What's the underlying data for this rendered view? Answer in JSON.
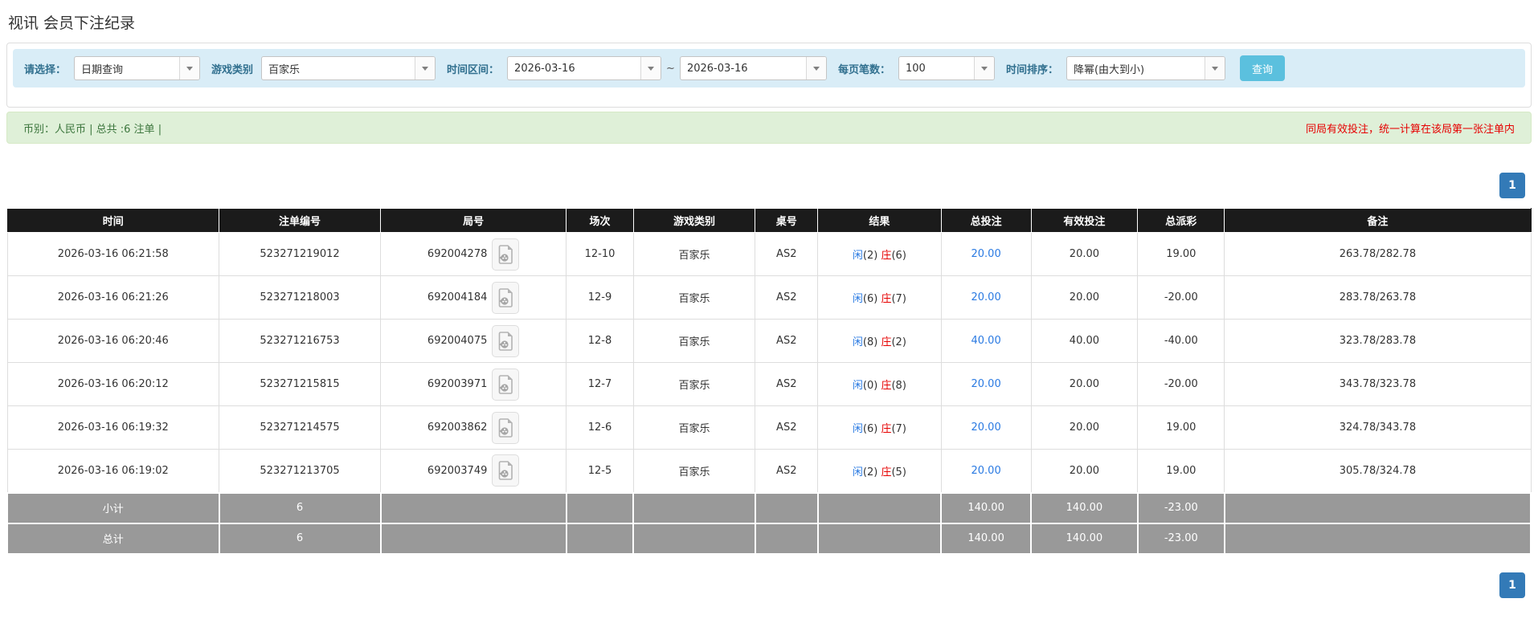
{
  "page": {
    "title": "视讯 会员下注纪录"
  },
  "filters": {
    "select_label": "请选择：",
    "select_value": "日期查询",
    "game_type_label": "游戏类别",
    "game_type_value": "百家乐",
    "date_range_label": "时间区间：",
    "date_from": "2026-03-16",
    "tilde": "~",
    "date_to": "2026-03-16",
    "page_size_label": "每页笔数：",
    "page_size_value": "100",
    "sort_label": "时间排序：",
    "sort_value": "降幂(由大到小)",
    "search_button": "查询"
  },
  "summary": {
    "left_text": "币别：人民币 | 总共 :6 注单 |",
    "right_note": "同局有效投注，统一计算在该局第一张注单内"
  },
  "pagination": {
    "page": "1"
  },
  "table": {
    "headers": [
      "时间",
      "注单编号",
      "局号",
      "场次",
      "游戏类别",
      "桌号",
      "结果",
      "总投注",
      "有效投注",
      "总派彩",
      "备注"
    ],
    "rows": [
      {
        "time": "2026-03-16 06:21:58",
        "bet_id": "523271219012",
        "round_id": "692004278",
        "session": "12-10",
        "game": "百家乐",
        "table_no": "AS2",
        "player_label": "闲",
        "player_num": "(2)",
        "banker_label": "庄",
        "banker_num": "(6)",
        "total_bet": "20.00",
        "valid_bet": "20.00",
        "payout": "19.00",
        "remark": "263.78/282.78"
      },
      {
        "time": "2026-03-16 06:21:26",
        "bet_id": "523271218003",
        "round_id": "692004184",
        "session": "12-9",
        "game": "百家乐",
        "table_no": "AS2",
        "player_label": "闲",
        "player_num": "(6)",
        "banker_label": "庄",
        "banker_num": "(7)",
        "total_bet": "20.00",
        "valid_bet": "20.00",
        "payout": "-20.00",
        "remark": "283.78/263.78"
      },
      {
        "time": "2026-03-16 06:20:46",
        "bet_id": "523271216753",
        "round_id": "692004075",
        "session": "12-8",
        "game": "百家乐",
        "table_no": "AS2",
        "player_label": "闲",
        "player_num": "(8)",
        "banker_label": "庄",
        "banker_num": "(2)",
        "total_bet": "40.00",
        "valid_bet": "40.00",
        "payout": "-40.00",
        "remark": "323.78/283.78"
      },
      {
        "time": "2026-03-16 06:20:12",
        "bet_id": "523271215815",
        "round_id": "692003971",
        "session": "12-7",
        "game": "百家乐",
        "table_no": "AS2",
        "player_label": "闲",
        "player_num": "(0)",
        "banker_label": "庄",
        "banker_num": "(8)",
        "total_bet": "20.00",
        "valid_bet": "20.00",
        "payout": "-20.00",
        "remark": "343.78/323.78"
      },
      {
        "time": "2026-03-16 06:19:32",
        "bet_id": "523271214575",
        "round_id": "692003862",
        "session": "12-6",
        "game": "百家乐",
        "table_no": "AS2",
        "player_label": "闲",
        "player_num": "(6)",
        "banker_label": "庄",
        "banker_num": "(7)",
        "total_bet": "20.00",
        "valid_bet": "20.00",
        "payout": "19.00",
        "remark": "324.78/343.78"
      },
      {
        "time": "2026-03-16 06:19:02",
        "bet_id": "523271213705",
        "round_id": "692003749",
        "session": "12-5",
        "game": "百家乐",
        "table_no": "AS2",
        "player_label": "闲",
        "player_num": "(2)",
        "banker_label": "庄",
        "banker_num": "(5)",
        "total_bet": "20.00",
        "valid_bet": "20.00",
        "payout": "19.00",
        "remark": "305.78/324.78"
      }
    ],
    "subtotal": {
      "label": "小计",
      "count": "6",
      "total_bet": "140.00",
      "valid_bet": "140.00",
      "payout": "-23.00"
    },
    "total": {
      "label": "总计",
      "count": "6",
      "total_bet": "140.00",
      "valid_bet": "140.00",
      "payout": "-23.00"
    }
  },
  "colors": {
    "accent_blue": "#337ab7",
    "link_blue": "#2a7ae2",
    "player_blue": "#2a7ae2",
    "banker_red": "#e60000",
    "negative_red": "#ee0000",
    "button_cyan": "#5bc0de",
    "header_bg": "#1b1b1b",
    "footer_bg": "#999999",
    "filter_bg": "#d9edf7",
    "summary_bg": "#dff0d8",
    "summary_border": "#d6e9c6",
    "summary_text": "#3c763d",
    "label_blue": "#31708f",
    "note_red": "#e60000"
  }
}
